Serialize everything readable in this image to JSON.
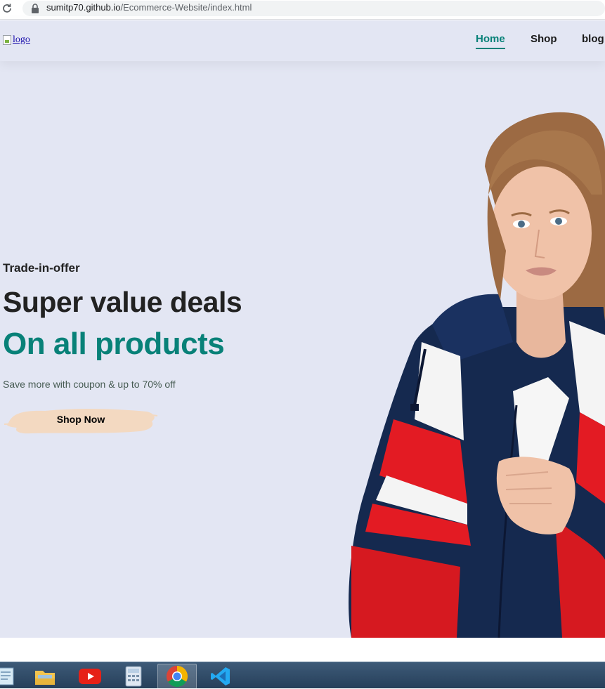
{
  "browser": {
    "url_host": "sumitp70.github.io",
    "url_path": "/Ecommerce-Website/index.html"
  },
  "header": {
    "logo_alt": "logo",
    "nav": [
      {
        "label": "Home",
        "active": true
      },
      {
        "label": "Shop",
        "active": false
      },
      {
        "label": "blog",
        "active": false
      }
    ]
  },
  "hero": {
    "eyebrow": "Trade-in-offer",
    "headline": "Super value deals",
    "headline_accent": "On all products",
    "subtext": "Save more with coupon & up to 70% off",
    "button_label": "Shop Now"
  },
  "colors": {
    "accent": "#088178",
    "hero_bg": "#e3e6f3",
    "button_bg": "#f3d9c1",
    "text_dark": "#222222"
  },
  "taskbar": {
    "apps": [
      "notepad-icon",
      "file-explorer-icon",
      "youtube-icon",
      "calculator-icon",
      "chrome-icon",
      "vscode-icon"
    ]
  }
}
